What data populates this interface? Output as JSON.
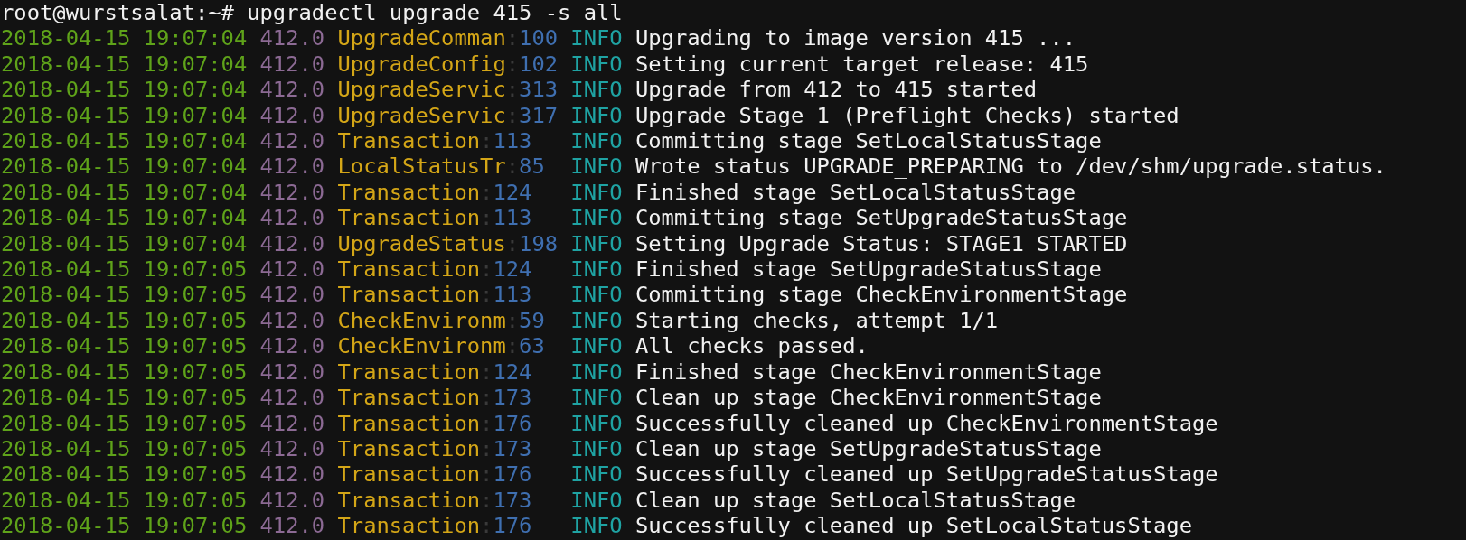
{
  "prompt": {
    "user_host": "root@wurstsalat:~#",
    "command": "upgradectl upgrade 415 -s all"
  },
  "log_lines": [
    {
      "timestamp": "2018-04-15 19:07:04",
      "version": "412.0",
      "source": "UpgradeComman",
      "sep": ":",
      "line": "100",
      "level": "INFO",
      "message": "Upgrading to image version 415 ..."
    },
    {
      "timestamp": "2018-04-15 19:07:04",
      "version": "412.0",
      "source": "UpgradeConfig",
      "sep": ":",
      "line": "102",
      "level": "INFO",
      "message": "Setting current target release: 415"
    },
    {
      "timestamp": "2018-04-15 19:07:04",
      "version": "412.0",
      "source": "UpgradeServic",
      "sep": ":",
      "line": "313",
      "level": "INFO",
      "message": "Upgrade from 412 to 415 started"
    },
    {
      "timestamp": "2018-04-15 19:07:04",
      "version": "412.0",
      "source": "UpgradeServic",
      "sep": ":",
      "line": "317",
      "level": "INFO",
      "message": "Upgrade Stage 1 (Preflight Checks) started"
    },
    {
      "timestamp": "2018-04-15 19:07:04",
      "version": "412.0",
      "source": "Transaction",
      "sep": ":",
      "line": "113",
      "level": "INFO",
      "message": "Committing stage SetLocalStatusStage"
    },
    {
      "timestamp": "2018-04-15 19:07:04",
      "version": "412.0",
      "source": "LocalStatusTr",
      "sep": ":",
      "line": "85",
      "level": "INFO",
      "message": "Wrote status UPGRADE_PREPARING to /dev/shm/upgrade.status."
    },
    {
      "timestamp": "2018-04-15 19:07:04",
      "version": "412.0",
      "source": "Transaction",
      "sep": ":",
      "line": "124",
      "level": "INFO",
      "message": "Finished stage SetLocalStatusStage"
    },
    {
      "timestamp": "2018-04-15 19:07:04",
      "version": "412.0",
      "source": "Transaction",
      "sep": ":",
      "line": "113",
      "level": "INFO",
      "message": "Committing stage SetUpgradeStatusStage"
    },
    {
      "timestamp": "2018-04-15 19:07:04",
      "version": "412.0",
      "source": "UpgradeStatus",
      "sep": ":",
      "line": "198",
      "level": "INFO",
      "message": "Setting Upgrade Status: STAGE1_STARTED"
    },
    {
      "timestamp": "2018-04-15 19:07:05",
      "version": "412.0",
      "source": "Transaction",
      "sep": ":",
      "line": "124",
      "level": "INFO",
      "message": "Finished stage SetUpgradeStatusStage"
    },
    {
      "timestamp": "2018-04-15 19:07:05",
      "version": "412.0",
      "source": "Transaction",
      "sep": ":",
      "line": "113",
      "level": "INFO",
      "message": "Committing stage CheckEnvironmentStage"
    },
    {
      "timestamp": "2018-04-15 19:07:05",
      "version": "412.0",
      "source": "CheckEnvironm",
      "sep": ":",
      "line": "59",
      "level": "INFO",
      "message": "Starting checks, attempt 1/1"
    },
    {
      "timestamp": "2018-04-15 19:07:05",
      "version": "412.0",
      "source": "CheckEnvironm",
      "sep": ":",
      "line": "63",
      "level": "INFO",
      "message": "All checks passed."
    },
    {
      "timestamp": "2018-04-15 19:07:05",
      "version": "412.0",
      "source": "Transaction",
      "sep": ":",
      "line": "124",
      "level": "INFO",
      "message": "Finished stage CheckEnvironmentStage"
    },
    {
      "timestamp": "2018-04-15 19:07:05",
      "version": "412.0",
      "source": "Transaction",
      "sep": ":",
      "line": "173",
      "level": "INFO",
      "message": "Clean up stage CheckEnvironmentStage"
    },
    {
      "timestamp": "2018-04-15 19:07:05",
      "version": "412.0",
      "source": "Transaction",
      "sep": ":",
      "line": "176",
      "level": "INFO",
      "message": "Successfully cleaned up CheckEnvironmentStage"
    },
    {
      "timestamp": "2018-04-15 19:07:05",
      "version": "412.0",
      "source": "Transaction",
      "sep": ":",
      "line": "173",
      "level": "INFO",
      "message": "Clean up stage SetUpgradeStatusStage"
    },
    {
      "timestamp": "2018-04-15 19:07:05",
      "version": "412.0",
      "source": "Transaction",
      "sep": ":",
      "line": "176",
      "level": "INFO",
      "message": "Successfully cleaned up SetUpgradeStatusStage"
    },
    {
      "timestamp": "2018-04-15 19:07:05",
      "version": "412.0",
      "source": "Transaction",
      "sep": ":",
      "line": "173",
      "level": "INFO",
      "message": "Clean up stage SetLocalStatusStage"
    },
    {
      "timestamp": "2018-04-15 19:07:05",
      "version": "412.0",
      "source": "Transaction",
      "sep": ":",
      "line": "176",
      "level": "INFO",
      "message": "Successfully cleaned up SetLocalStatusStage"
    }
  ]
}
